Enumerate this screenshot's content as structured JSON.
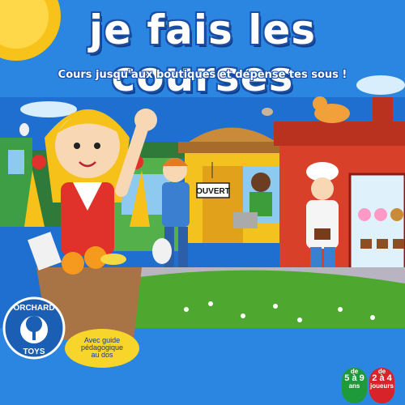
{
  "box": {
    "title": "je fais les courses",
    "subtitle": "Cours jusqu'aux boutiques et dépense tes sous !",
    "shop_sign": "OUVERT",
    "logo": {
      "top_text": "ORCHARD",
      "bottom_text": "TOYS"
    },
    "guide_note": [
      "Avec guide",
      "pédagogique",
      "au dos"
    ],
    "age_badge": {
      "line1": "de",
      "line2": "5 à 9",
      "line3": "ans"
    },
    "players_badge": {
      "line1": "de",
      "line2": "2 à 4",
      "line3": "joueurs"
    }
  },
  "colors": {
    "background_blue": "#1e6fd0",
    "sun_yellow": "#f7c21a",
    "grass_green": "#4ea72e",
    "shop_red": "#d8402a",
    "logo_blue": "#1a5fb4"
  }
}
